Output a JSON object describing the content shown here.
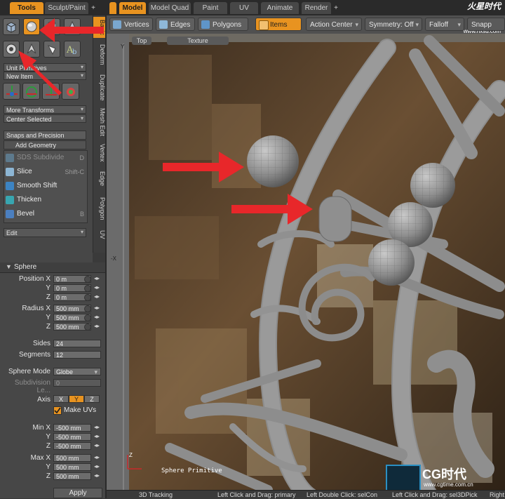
{
  "tool_tabs": [
    "Tools",
    "Sculpt/Paint",
    "+"
  ],
  "main_tabs": [
    "Model",
    "Model Quad",
    "Paint",
    "UV",
    "Animate",
    "Render",
    "+"
  ],
  "watermark": {
    "brand": "火星时代",
    "url": "www.hxsd.com",
    "logo_text": "CG时代",
    "logo_url": "www.cgtime.com.cn"
  },
  "toolbar": {
    "vertices": "Vertices",
    "edges": "Edges",
    "polygons": "Polygons",
    "items": "Items",
    "action_center": "Action Center",
    "symmetry": "Symmetry: Off",
    "falloff": "Falloff",
    "snapping": "Snapp"
  },
  "left_vtabs": [
    "Basic",
    "Deform",
    "Duplicate",
    "Mesh Edit",
    "Vertex",
    "Edge",
    "Polygon",
    "UV"
  ],
  "left_panel": {
    "unit_primitives": "Unit Primitives",
    "new_item": "New Item",
    "more_transforms": "More Transforms",
    "center_selected": "Center Selected",
    "snaps_precision": "Snaps and Precision",
    "add_geometry": "Add Geometry",
    "tools": [
      {
        "label": "SDS Subdivide",
        "key": "D",
        "color": "#6aa3c9",
        "dim": true
      },
      {
        "label": "Slice",
        "key": "Shift-C",
        "color": "#8db6d4",
        "dim": false
      },
      {
        "label": "Smooth Shift",
        "key": "",
        "color": "#3c83c2",
        "dim": false
      },
      {
        "label": "Thicken",
        "key": "",
        "color": "#38a6b0",
        "dim": false
      },
      {
        "label": "Bevel",
        "key": "B",
        "color": "#4b7fbf",
        "dim": false
      }
    ],
    "edit": "Edit"
  },
  "properties": {
    "title": "Sphere",
    "position_label": "Position X",
    "position": [
      "0 m",
      "0 m",
      "0 m"
    ],
    "radius_label": "Radius X",
    "radius": [
      "500 mm",
      "500 mm",
      "500 mm"
    ],
    "axis_labels": [
      "X",
      "Y",
      "Z"
    ],
    "sides_label": "Sides",
    "sides": "24",
    "segments_label": "Segments",
    "segments": "12",
    "sphere_mode_label": "Sphere Mode",
    "sphere_mode": "Globe",
    "subdivision_label": "Subdivision Le...",
    "subdivision": "0",
    "axis_label": "Axis",
    "axis_options": [
      "X",
      "Y",
      "Z"
    ],
    "axis_selected": "Y",
    "make_uvs": "Make UVs",
    "min_label": "Min X",
    "min": [
      "-500 mm",
      "-500 mm",
      "-500 mm"
    ],
    "max_label": "Max X",
    "max": [
      "500 mm",
      "500 mm",
      "500 mm"
    ],
    "apply": "Apply"
  },
  "viewport": {
    "tabs": [
      "Top",
      "Texture"
    ],
    "axis_y": "Y",
    "axis_x": "-X",
    "axis_z": "Z",
    "hud": "Sphere Primitive"
  },
  "status": {
    "tracking": "3D Tracking",
    "hint1": "Left Click and Drag: primary",
    "hint2": "Left Double Click: selCon",
    "hint3": "Left Click and Drag: sel3DPick",
    "hint4": "Right"
  },
  "colors": {
    "accent": "#e89320",
    "arrow": "#e8272a",
    "panel": "#474747",
    "mesh": "#8a8a8a"
  }
}
